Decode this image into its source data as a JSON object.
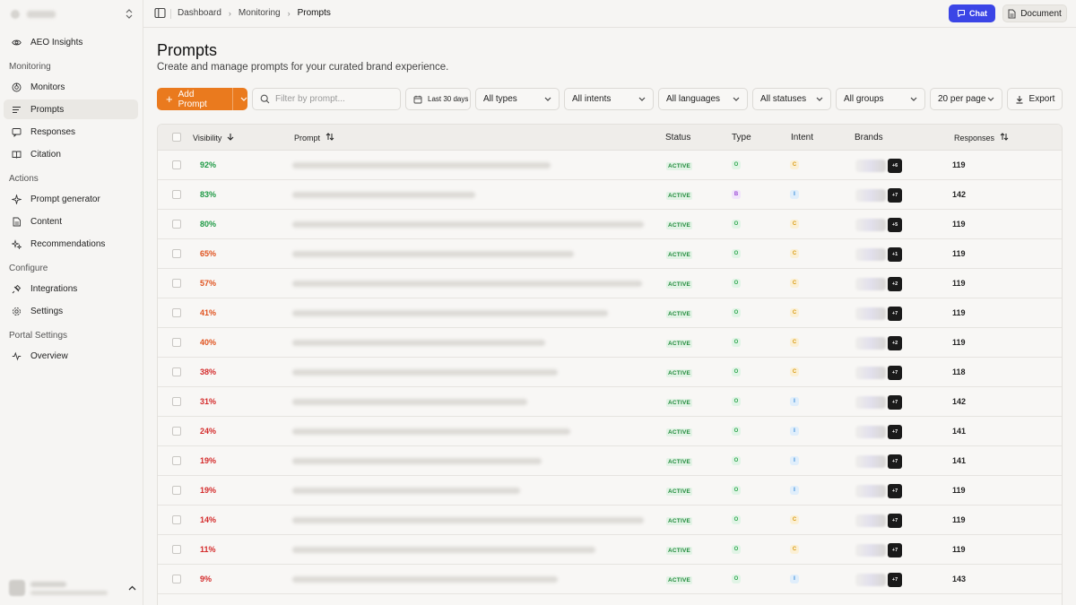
{
  "sidebar": {
    "top_items": [
      {
        "label": "AEO Insights",
        "icon": "eye-icon"
      }
    ],
    "sections": [
      {
        "title": "Monitoring",
        "items": [
          {
            "label": "Monitors",
            "icon": "radar-icon"
          },
          {
            "label": "Prompts",
            "icon": "list-icon",
            "active": true
          },
          {
            "label": "Responses",
            "icon": "message-icon"
          },
          {
            "label": "Citation",
            "icon": "book-icon"
          }
        ]
      },
      {
        "title": "Actions",
        "items": [
          {
            "label": "Prompt generator",
            "icon": "sparkle-icon"
          },
          {
            "label": "Content",
            "icon": "document-icon"
          },
          {
            "label": "Recommendations",
            "icon": "sparkles-icon"
          }
        ]
      },
      {
        "title": "Configure",
        "items": [
          {
            "label": "Integrations",
            "icon": "plug-icon"
          },
          {
            "label": "Settings",
            "icon": "gear-icon"
          }
        ]
      },
      {
        "title": "Portal Settings",
        "items": [
          {
            "label": "Overview",
            "icon": "activity-icon"
          }
        ]
      }
    ]
  },
  "topbar": {
    "breadcrumb": [
      "Dashboard",
      "Monitoring",
      "Prompts"
    ],
    "chat_label": "Chat",
    "document_label": "Document"
  },
  "page": {
    "title": "Prompts",
    "subtitle": "Create and manage prompts for your curated brand experience."
  },
  "toolbar": {
    "add_label": "Add Prompt",
    "search_placeholder": "Filter by prompt...",
    "date_label": "Last 30 days",
    "filters": [
      "All types",
      "All intents",
      "All languages",
      "All statuses",
      "All groups",
      "20 per page"
    ],
    "export_label": "Export"
  },
  "table": {
    "columns": [
      "Visibility",
      "Prompt",
      "Status",
      "Type",
      "Intent",
      "Brands",
      "Responses"
    ],
    "rows": [
      {
        "visibility": "92%",
        "status": "ACTIVE",
        "type": "O",
        "intent": "C",
        "brands_more": "+6",
        "responses": "119"
      },
      {
        "visibility": "83%",
        "status": "ACTIVE",
        "type": "B",
        "intent": "I",
        "brands_more": "+7",
        "responses": "142"
      },
      {
        "visibility": "80%",
        "status": "ACTIVE",
        "type": "O",
        "intent": "C",
        "brands_more": "+5",
        "responses": "119"
      },
      {
        "visibility": "65%",
        "status": "ACTIVE",
        "type": "O",
        "intent": "C",
        "brands_more": "+1",
        "responses": "119"
      },
      {
        "visibility": "57%",
        "status": "ACTIVE",
        "type": "O",
        "intent": "C",
        "brands_more": "+2",
        "responses": "119"
      },
      {
        "visibility": "41%",
        "status": "ACTIVE",
        "type": "O",
        "intent": "C",
        "brands_more": "+7",
        "responses": "119"
      },
      {
        "visibility": "40%",
        "status": "ACTIVE",
        "type": "O",
        "intent": "C",
        "brands_more": "+2",
        "responses": "119"
      },
      {
        "visibility": "38%",
        "status": "ACTIVE",
        "type": "O",
        "intent": "C",
        "brands_more": "+7",
        "responses": "118"
      },
      {
        "visibility": "31%",
        "status": "ACTIVE",
        "type": "O",
        "intent": "I",
        "brands_more": "+7",
        "responses": "142"
      },
      {
        "visibility": "24%",
        "status": "ACTIVE",
        "type": "O",
        "intent": "I",
        "brands_more": "+7",
        "responses": "141"
      },
      {
        "visibility": "19%",
        "status": "ACTIVE",
        "type": "O",
        "intent": "I",
        "brands_more": "+7",
        "responses": "141"
      },
      {
        "visibility": "19%",
        "status": "ACTIVE",
        "type": "O",
        "intent": "I",
        "brands_more": "+7",
        "responses": "119"
      },
      {
        "visibility": "14%",
        "status": "ACTIVE",
        "type": "O",
        "intent": "C",
        "brands_more": "+7",
        "responses": "119"
      },
      {
        "visibility": "11%",
        "status": "ACTIVE",
        "type": "O",
        "intent": "C",
        "brands_more": "+7",
        "responses": "119"
      },
      {
        "visibility": "9%",
        "status": "ACTIVE",
        "type": "O",
        "intent": "I",
        "brands_more": "+7",
        "responses": "143"
      }
    ]
  },
  "colors": {
    "accent_orange": "#ea7a1e",
    "chat_blue": "#3b45e6",
    "visibility_high": "#1f9a45",
    "visibility_mid": "#e0531f",
    "visibility_low": "#d42b2b",
    "status_green": "#1f8a3a",
    "type_o": "#2fa84f",
    "type_b": "#9b4ad6",
    "intent_c": "#d99b12",
    "intent_i": "#2a86d6"
  }
}
